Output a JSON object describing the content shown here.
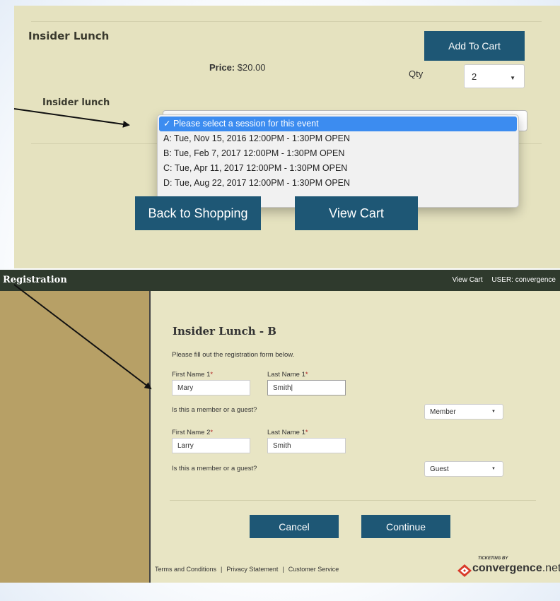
{
  "top": {
    "title": "Insider Lunch",
    "add_to_cart": "Add To Cart",
    "price_label": "Price:",
    "price_value": "$20.00",
    "qty_label": "Qty",
    "qty_value": "2",
    "session_label": "Insider lunch",
    "dropdown_options": [
      "✓  Please select a session for this event",
      "A:  Tue, Nov 15, 2016 12:00PM - 1:30PM  OPEN",
      "B:  Tue, Feb 7, 2017 12:00PM - 1:30PM  OPEN",
      "C:  Tue, Apr 11, 2017 12:00PM - 1:30PM  OPEN",
      "D:  Tue, Aug 22, 2017 12:00PM - 1:30PM  OPEN"
    ],
    "back_button": "Back to Shopping",
    "view_cart_button": "View Cart"
  },
  "reg": {
    "bar_title": "Registration",
    "view_cart_link": "View Cart",
    "user_label": "USER: convergence",
    "form_title": "Insider Lunch - B",
    "form_desc": "Please fill out the registration form below.",
    "first_name_1_label": "First Name 1",
    "last_name_1_label": "Last Name 1",
    "first_name_1": "Mary",
    "last_name_1": "Smith|",
    "member_q_1": "Is this a member or a guest?",
    "member_value_1": "Member",
    "first_name_2_label": "First Name 2",
    "last_name_2_label": "Last Name 1",
    "first_name_2": "Larry",
    "last_name_2": "Smith",
    "member_q_2": "Is this a member or a guest?",
    "member_value_2": "Guest",
    "required_mark": "*",
    "cancel_button": "Cancel",
    "continue_button": "Continue"
  },
  "footer": {
    "terms": "Terms and Conditions",
    "privacy": "Privacy Statement",
    "service": "Customer Service",
    "separator": "|",
    "logo_small": "TICKETING BY",
    "logo_main": "convergence",
    "logo_suffix": ".net"
  },
  "colors": {
    "top_panel_bg": "#e5e2bf",
    "button_blue": "#1e5775",
    "reg_bar": "#2f3a2d",
    "sidebar": "#b7a066",
    "main_bg": "#e8e5c4",
    "dropdown_highlight": "#3c8cf0",
    "logo_red": "#d93a2a"
  }
}
